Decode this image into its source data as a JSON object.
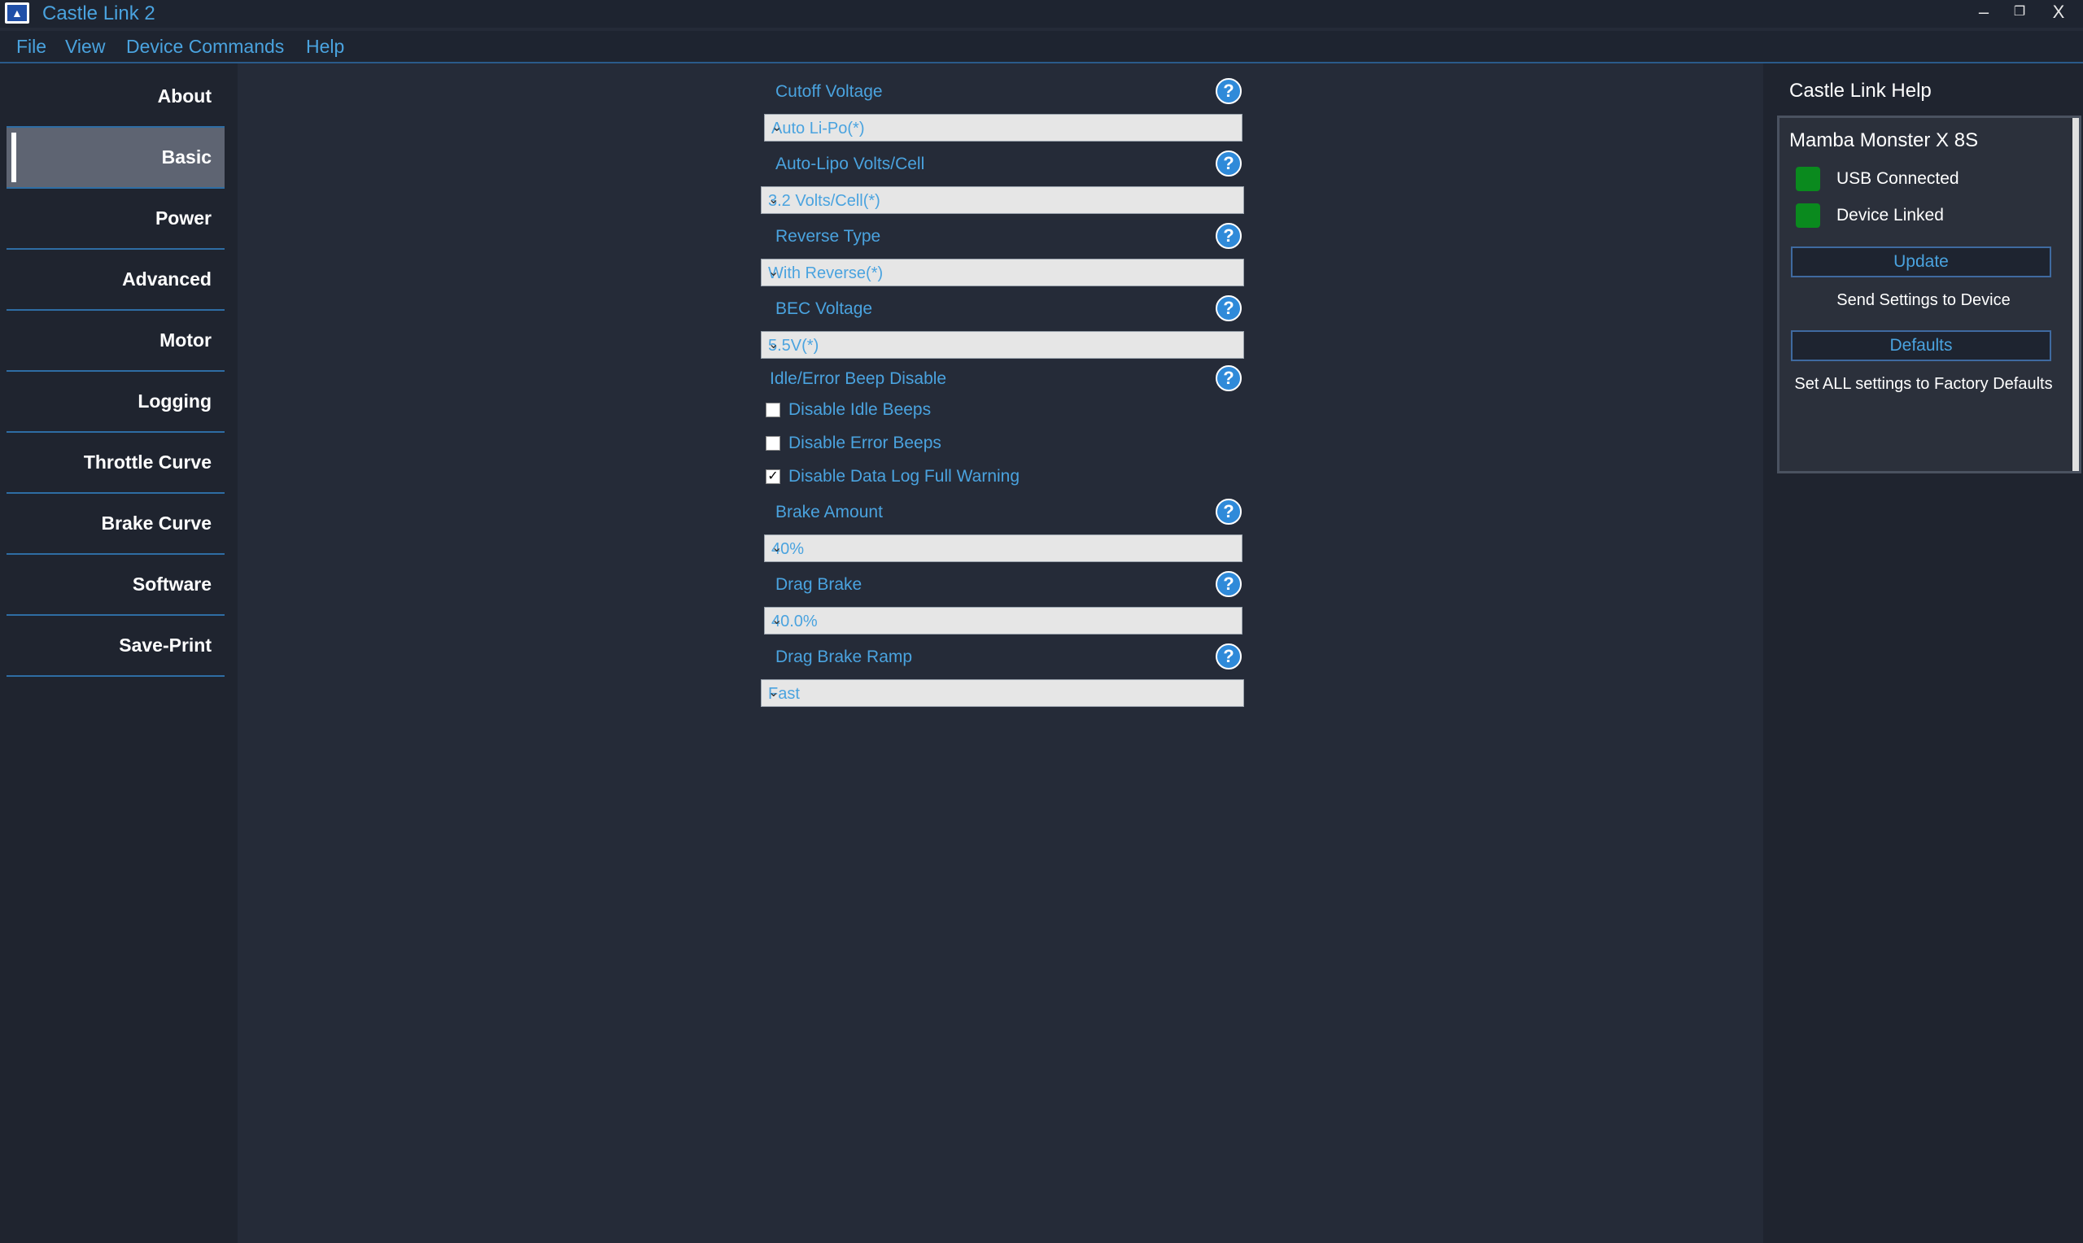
{
  "window": {
    "title": "Castle Link 2",
    "minimize": "–",
    "restore": "❐",
    "close": "X"
  },
  "menu": [
    "File",
    "View",
    "Device Commands",
    "Help"
  ],
  "sidebar": {
    "items": [
      {
        "label": "About",
        "active": false
      },
      {
        "label": "Basic",
        "active": true
      },
      {
        "label": "Power",
        "active": false
      },
      {
        "label": "Advanced",
        "active": false
      },
      {
        "label": "Motor",
        "active": false
      },
      {
        "label": "Logging",
        "active": false
      },
      {
        "label": "Throttle Curve",
        "active": false
      },
      {
        "label": "Brake Curve",
        "active": false
      },
      {
        "label": "Software",
        "active": false
      },
      {
        "label": "Save-Print",
        "active": false
      }
    ]
  },
  "settings": {
    "cutoff_voltage": {
      "label": "Cutoff Voltage",
      "value": "Auto Li-Po(*)"
    },
    "auto_lipo": {
      "label": "Auto-Lipo Volts/Cell",
      "value": "3.2 Volts/Cell(*)"
    },
    "reverse_type": {
      "label": "Reverse Type",
      "value": "With Reverse(*)"
    },
    "bec_voltage": {
      "label": "BEC Voltage",
      "value": "5.5V(*)"
    },
    "beep_disable": {
      "label": "Idle/Error Beep Disable",
      "options": [
        {
          "label": "Disable Idle Beeps",
          "checked": false,
          "mark": ""
        },
        {
          "label": "Disable Error Beeps",
          "checked": false,
          "mark": ""
        },
        {
          "label": "Disable Data Log Full Warning",
          "checked": true,
          "mark": "✓"
        }
      ]
    },
    "brake_amount": {
      "label": "Brake Amount",
      "value": "40%"
    },
    "drag_brake": {
      "label": "Drag Brake",
      "value": "40.0%"
    },
    "drag_brake_ramp": {
      "label": "Drag Brake Ramp",
      "value": "Fast"
    },
    "help_glyph": "?",
    "dropdown_glyph": "⌄"
  },
  "help_panel": {
    "title": "Castle Link Help",
    "device": "Mamba Monster X 8S",
    "usb_status": "USB Connected",
    "link_status": "Device Linked",
    "status_color": "#0a8a1e",
    "update_button": "Update",
    "update_caption": "Send Settings to Device",
    "defaults_button": "Defaults",
    "defaults_caption": "Set ALL settings to Factory Defaults"
  }
}
